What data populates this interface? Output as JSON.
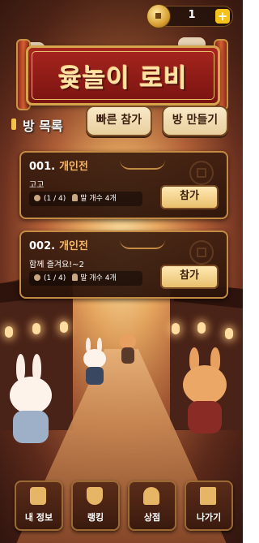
{
  "header": {
    "coins": "1",
    "add_coins_label": "+",
    "title": "윷놀이 로비"
  },
  "room_list": {
    "title": "방 목록",
    "quick_join_label": "빠른 참가",
    "create_room_label": "방 만들기"
  },
  "rooms": [
    {
      "number": "001.",
      "mode": "개인전",
      "name": "고고",
      "players": "(1 / 4)",
      "pieces": "말 개수  4개",
      "join_label": "참가"
    },
    {
      "number": "002.",
      "mode": "개인전",
      "name": "함께 즐겨요!~2",
      "players": "(1 / 4)",
      "pieces": "말 개수  4개",
      "join_label": "참가"
    }
  ],
  "bottom_nav": [
    {
      "label": "내 정보",
      "icon": "profile-icon"
    },
    {
      "label": "랭킹",
      "icon": "trophy-icon"
    },
    {
      "label": "상점",
      "icon": "shop-icon"
    },
    {
      "label": "나가기",
      "icon": "exit-icon"
    }
  ],
  "colors": {
    "accent": "#f5c21b",
    "banner": "#a8251f",
    "gold_border": "#c38b43"
  }
}
